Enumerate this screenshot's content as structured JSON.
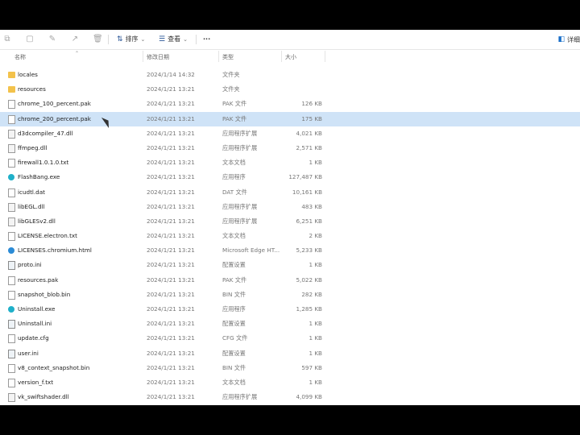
{
  "toolbar": {
    "sort_label": "排序",
    "view_label": "查看",
    "more_label": "···",
    "details_label": "详细"
  },
  "columns": {
    "name": "名称",
    "date": "修改日期",
    "type": "类型",
    "size": "大小"
  },
  "files": [
    {
      "name": "locales",
      "date": "2024/1/14 14:32",
      "type": "文件夹",
      "size": "",
      "icon": "folder"
    },
    {
      "name": "resources",
      "date": "2024/1/21 13:21",
      "type": "文件夹",
      "size": "",
      "icon": "folder"
    },
    {
      "name": "chrome_100_percent.pak",
      "date": "2024/1/21 13:21",
      "type": "PAK 文件",
      "size": "126 KB",
      "icon": "file"
    },
    {
      "name": "chrome_200_percent.pak",
      "date": "2024/1/21 13:21",
      "type": "PAK 文件",
      "size": "175 KB",
      "icon": "file",
      "state": "selected"
    },
    {
      "name": "d3dcompiler_47.dll",
      "date": "2024/1/21 13:21",
      "type": "应用程序扩展",
      "size": "4,021 KB",
      "icon": "dll"
    },
    {
      "name": "ffmpeg.dll",
      "date": "2024/1/21 13:21",
      "type": "应用程序扩展",
      "size": "2,571 KB",
      "icon": "dll"
    },
    {
      "name": "firewall1.0.1.0.txt",
      "date": "2024/1/21 13:21",
      "type": "文本文档",
      "size": "1 KB",
      "icon": "txt"
    },
    {
      "name": "FlashBang.exe",
      "date": "2024/1/21 13:21",
      "type": "应用程序",
      "size": "127,487 KB",
      "icon": "exe"
    },
    {
      "name": "icudtl.dat",
      "date": "2024/1/21 13:21",
      "type": "DAT 文件",
      "size": "10,161 KB",
      "icon": "file"
    },
    {
      "name": "libEGL.dll",
      "date": "2024/1/21 13:21",
      "type": "应用程序扩展",
      "size": "483 KB",
      "icon": "dll"
    },
    {
      "name": "libGLESv2.dll",
      "date": "2024/1/21 13:21",
      "type": "应用程序扩展",
      "size": "6,251 KB",
      "icon": "dll"
    },
    {
      "name": "LICENSE.electron.txt",
      "date": "2024/1/21 13:21",
      "type": "文本文档",
      "size": "2 KB",
      "icon": "txt"
    },
    {
      "name": "LICENSES.chromium.html",
      "date": "2024/1/21 13:21",
      "type": "Microsoft Edge HT...",
      "size": "5,233 KB",
      "icon": "edge"
    },
    {
      "name": "proto.ini",
      "date": "2024/1/21 13:21",
      "type": "配置设置",
      "size": "1 KB",
      "icon": "ini"
    },
    {
      "name": "resources.pak",
      "date": "2024/1/21 13:21",
      "type": "PAK 文件",
      "size": "5,022 KB",
      "icon": "file"
    },
    {
      "name": "snapshot_blob.bin",
      "date": "2024/1/21 13:21",
      "type": "BIN 文件",
      "size": "282 KB",
      "icon": "file"
    },
    {
      "name": "Uninstall.exe",
      "date": "2024/1/21 13:21",
      "type": "应用程序",
      "size": "1,285 KB",
      "icon": "exe"
    },
    {
      "name": "Uninstall.ini",
      "date": "2024/1/21 13:21",
      "type": "配置设置",
      "size": "1 KB",
      "icon": "ini"
    },
    {
      "name": "update.cfg",
      "date": "2024/1/21 13:21",
      "type": "CFG 文件",
      "size": "1 KB",
      "icon": "file"
    },
    {
      "name": "user.ini",
      "date": "2024/1/21 13:21",
      "type": "配置设置",
      "size": "1 KB",
      "icon": "ini"
    },
    {
      "name": "v8_context_snapshot.bin",
      "date": "2024/1/21 13:21",
      "type": "BIN 文件",
      "size": "597 KB",
      "icon": "file"
    },
    {
      "name": "version_f.txt",
      "date": "2024/1/21 13:21",
      "type": "文本文档",
      "size": "1 KB",
      "icon": "txt"
    },
    {
      "name": "vk_swiftshader.dll",
      "date": "2024/1/21 13:21",
      "type": "应用程序扩展",
      "size": "4,099 KB",
      "icon": "dll"
    }
  ]
}
